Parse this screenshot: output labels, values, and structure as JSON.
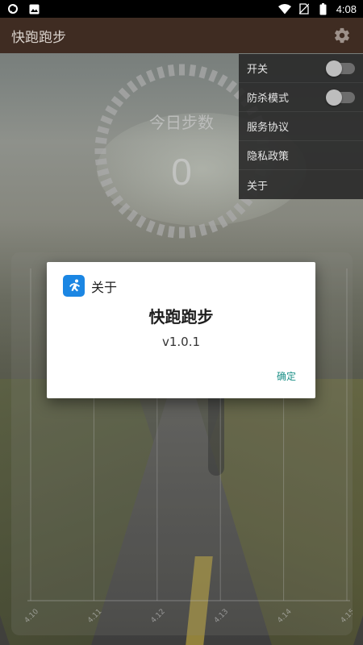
{
  "status_bar": {
    "time": "4:08",
    "left_icons": [
      "sync-icon",
      "image-icon"
    ],
    "right_icons": [
      "wifi-icon",
      "no-sim-icon",
      "battery-icon"
    ]
  },
  "app_bar": {
    "title": "快跑跑步",
    "settings_icon": "gear-icon"
  },
  "step_counter": {
    "label": "今日步数",
    "value": "0"
  },
  "chart": {
    "x_tick_labels": [
      "4.10",
      "4.11",
      "4.12",
      "4.13",
      "4.14",
      "4.15"
    ]
  },
  "chart_data": {
    "type": "line",
    "categories": [
      "4.10",
      "4.11",
      "4.12",
      "4.13",
      "4.14",
      "4.15"
    ],
    "series": [],
    "grid": true
  },
  "overflow_menu": {
    "items": [
      {
        "label": "开关",
        "toggle": false
      },
      {
        "label": "防杀模式",
        "toggle": false
      },
      {
        "label": "服务协议"
      },
      {
        "label": "隐私政策"
      },
      {
        "label": "关于"
      }
    ]
  },
  "dialog": {
    "title": "关于",
    "app_icon": "runner-icon",
    "app_name": "快跑跑步",
    "version": "v1.0.1",
    "ok_label": "确定"
  },
  "colors": {
    "app_bar": "#3f2c22",
    "accent": "#1a8f86",
    "app_icon_bg": "#1b86e3"
  }
}
